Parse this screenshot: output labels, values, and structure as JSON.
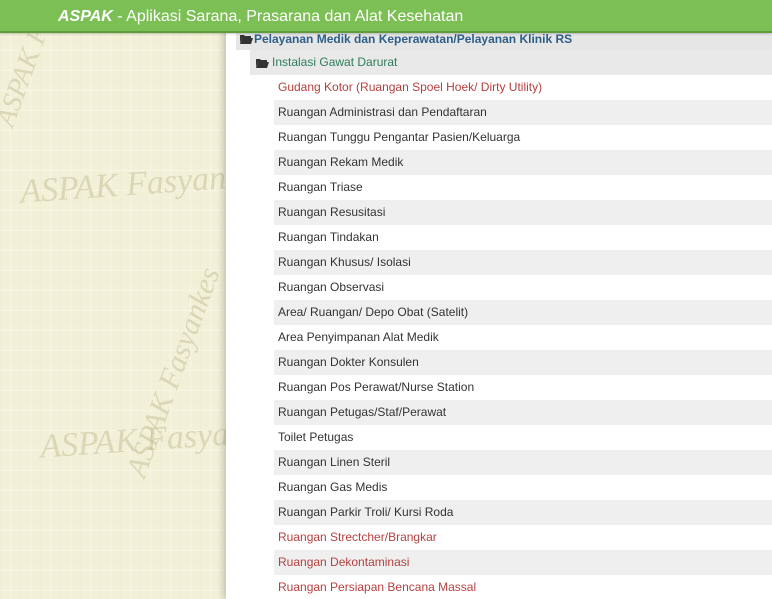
{
  "app": {
    "name": "ASPAK",
    "title_rest": " - Aplikasi Sarana, Prasarana dan Alat Kesehatan"
  },
  "watermark": {
    "text": "ASPAK Fasyankes"
  },
  "tree": {
    "root_label": "Pelayanan Medik dan Keperawatan/Pelayanan Klinik RS",
    "sub_label": "Instalasi Gawat Darurat",
    "items": [
      {
        "label": "Gudang Kotor (Ruangan Spoel Hoek/ Dirty Utility)",
        "status": "red"
      },
      {
        "label": "Ruangan Administrasi dan Pendaftaran",
        "status": "normal"
      },
      {
        "label": "Ruangan Tunggu Pengantar Pasien/Keluarga",
        "status": "normal"
      },
      {
        "label": "Ruangan Rekam Medik",
        "status": "normal"
      },
      {
        "label": "Ruangan Triase",
        "status": "normal"
      },
      {
        "label": "Ruangan Resusitasi",
        "status": "normal"
      },
      {
        "label": "Ruangan Tindakan",
        "status": "normal"
      },
      {
        "label": "Ruangan Khusus/ Isolasi",
        "status": "normal"
      },
      {
        "label": "Ruangan Observasi",
        "status": "normal"
      },
      {
        "label": "Area/ Ruangan/ Depo Obat (Satelit)",
        "status": "normal"
      },
      {
        "label": "Area Penyimpanan Alat Medik",
        "status": "normal"
      },
      {
        "label": "Ruangan Dokter Konsulen",
        "status": "normal"
      },
      {
        "label": "Ruangan Pos Perawat/Nurse Station",
        "status": "normal"
      },
      {
        "label": "Ruangan Petugas/Staf/Perawat",
        "status": "normal"
      },
      {
        "label": "Toilet Petugas",
        "status": "normal"
      },
      {
        "label": "Ruangan Linen Steril",
        "status": "normal"
      },
      {
        "label": "Ruangan Gas Medis",
        "status": "normal"
      },
      {
        "label": "Ruangan Parkir Troli/ Kursi Roda",
        "status": "normal"
      },
      {
        "label": "Ruangan Strectcher/Brangkar",
        "status": "red"
      },
      {
        "label": "Ruangan Dekontaminasi",
        "status": "red"
      },
      {
        "label": "Ruangan Persiapan Bencana Massal",
        "status": "red"
      }
    ]
  },
  "colors": {
    "topbar": "#7cbf55",
    "red_item": "#b5403f",
    "root_text": "#2d5f8a",
    "sub_text": "#2e7d5a"
  }
}
